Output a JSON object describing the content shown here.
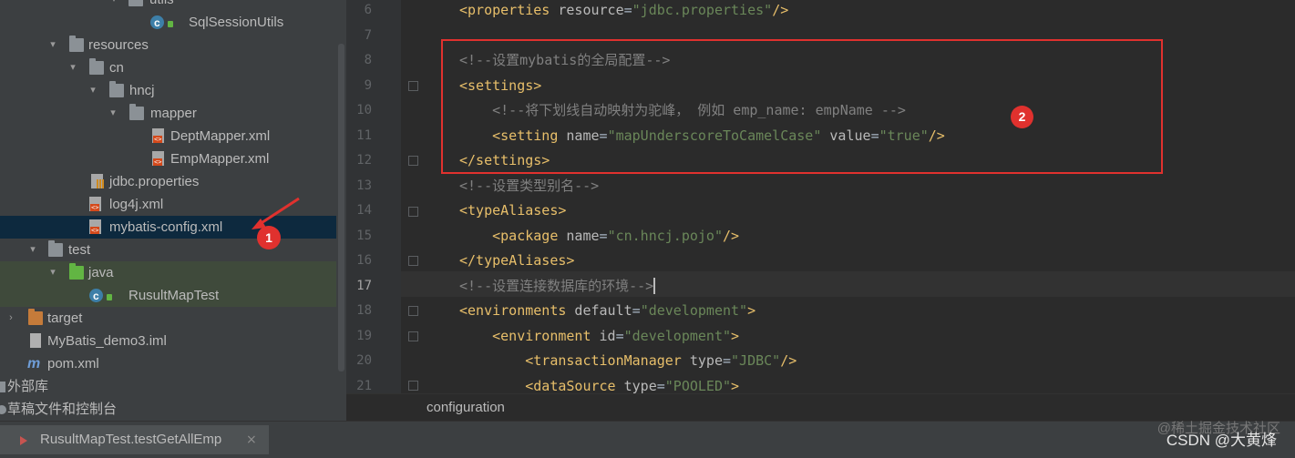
{
  "tree": {
    "items": [
      {
        "label": "utils"
      },
      {
        "label": "SqlSessionUtils"
      },
      {
        "label": "resources"
      },
      {
        "label": "cn"
      },
      {
        "label": "hncj"
      },
      {
        "label": "mapper"
      },
      {
        "label": "DeptMapper.xml"
      },
      {
        "label": "EmpMapper.xml"
      },
      {
        "label": "jdbc.properties"
      },
      {
        "label": "log4j.xml"
      },
      {
        "label": "mybatis-config.xml"
      },
      {
        "label": "test"
      },
      {
        "label": "java"
      },
      {
        "label": "RusultMapTest"
      },
      {
        "label": "target"
      },
      {
        "label": "MyBatis_demo3.iml"
      },
      {
        "label": "pom.xml"
      },
      {
        "label": "外部库"
      },
      {
        "label": "草稿文件和控制台"
      }
    ],
    "maven_glyph": "m"
  },
  "callouts": {
    "one": "1",
    "two": "2"
  },
  "editor": {
    "line_numbers": [
      "6",
      "7",
      "8",
      "9",
      "10",
      "11",
      "12",
      "13",
      "14",
      "15",
      "16",
      "17",
      "18",
      "19",
      "20",
      "21"
    ],
    "lines": [
      [
        {
          "k": "t",
          "s": "<properties"
        },
        {
          "k": "a",
          "s": " resource"
        },
        {
          "k": "p",
          "s": "="
        },
        {
          "k": "v",
          "s": "\"jdbc.properties\""
        },
        {
          "k": "t",
          "s": "/>"
        }
      ],
      [],
      [
        {
          "k": "c",
          "s": "<!--设置mybatis的全局配置-->"
        }
      ],
      [
        {
          "k": "t",
          "s": "<settings>"
        }
      ],
      [
        {
          "k": "c",
          "s": "    <!--将下划线自动映射为驼峰， 例如 emp_name: empName -->"
        }
      ],
      [
        {
          "k": "t",
          "s": "    <setting"
        },
        {
          "k": "a",
          "s": " name"
        },
        {
          "k": "p",
          "s": "="
        },
        {
          "k": "v",
          "s": "\"mapUnderscoreToCamelCase\""
        },
        {
          "k": "a",
          "s": " value"
        },
        {
          "k": "p",
          "s": "="
        },
        {
          "k": "v",
          "s": "\"true\""
        },
        {
          "k": "t",
          "s": "/>"
        }
      ],
      [
        {
          "k": "t",
          "s": "</settings>"
        }
      ],
      [
        {
          "k": "c",
          "s": "<!--设置类型别名-->"
        }
      ],
      [
        {
          "k": "t",
          "s": "<typeAliases>"
        }
      ],
      [
        {
          "k": "t",
          "s": "    <package"
        },
        {
          "k": "a",
          "s": " name"
        },
        {
          "k": "p",
          "s": "="
        },
        {
          "k": "v",
          "s": "\"cn.hncj.pojo\""
        },
        {
          "k": "t",
          "s": "/>"
        }
      ],
      [
        {
          "k": "t",
          "s": "</typeAliases>"
        }
      ],
      [
        {
          "k": "c",
          "s": "<!--设置连接数据库的环境-->"
        }
      ],
      [
        {
          "k": "t",
          "s": "<environments"
        },
        {
          "k": "a",
          "s": " default"
        },
        {
          "k": "p",
          "s": "="
        },
        {
          "k": "v",
          "s": "\"development\""
        },
        {
          "k": "t",
          "s": ">"
        }
      ],
      [
        {
          "k": "t",
          "s": "    <environment"
        },
        {
          "k": "a",
          "s": " id"
        },
        {
          "k": "p",
          "s": "="
        },
        {
          "k": "v",
          "s": "\"development\""
        },
        {
          "k": "t",
          "s": ">"
        }
      ],
      [
        {
          "k": "t",
          "s": "        <transactionManager"
        },
        {
          "k": "a",
          "s": " type"
        },
        {
          "k": "p",
          "s": "="
        },
        {
          "k": "v",
          "s": "\"JDBC\""
        },
        {
          "k": "t",
          "s": "/>"
        }
      ],
      [
        {
          "k": "t",
          "s": "        <dataSource"
        },
        {
          "k": "a",
          "s": " type"
        },
        {
          "k": "p",
          "s": "="
        },
        {
          "k": "v",
          "s": "\"POOLED\""
        },
        {
          "k": "t",
          "s": ">"
        }
      ]
    ]
  },
  "breadcrumb": "configuration",
  "run": {
    "tab_label": "RusultMapTest.testGetAllEmp",
    "close_glyph": "×"
  },
  "watermark": {
    "csdn": "CSDN @大黄烽",
    "juejin": "@稀土掘金技术社区"
  },
  "colors": {
    "accent_red": "#e0312e",
    "selection": "#0d293e"
  }
}
